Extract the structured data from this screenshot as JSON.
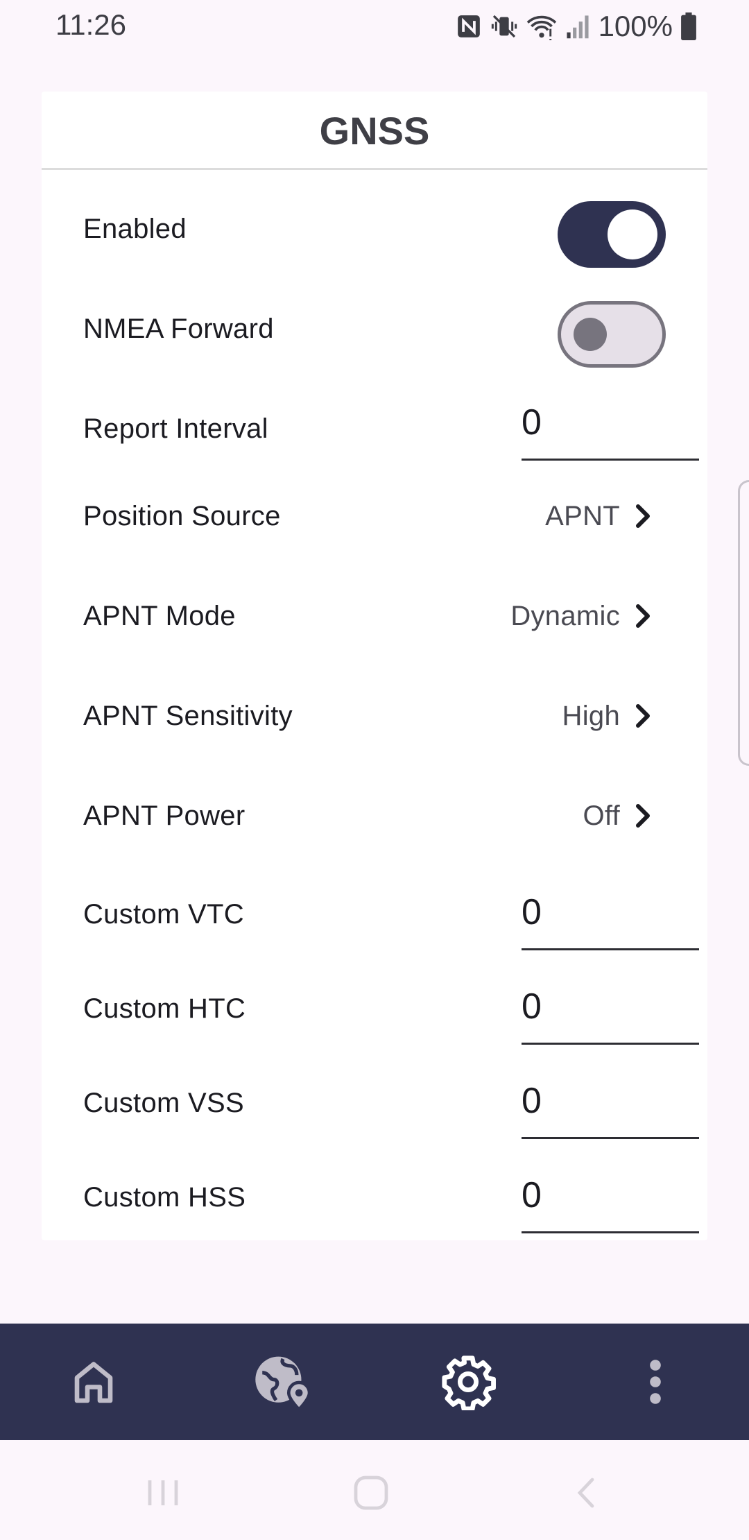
{
  "status_bar": {
    "time": "11:26",
    "battery": "100%",
    "icons": [
      "nfc-icon",
      "vibrate-mute-icon",
      "wifi-icon",
      "signal-icon",
      "battery-icon"
    ]
  },
  "card": {
    "title": "GNSS",
    "rows": {
      "enabled": {
        "label": "Enabled",
        "toggle": "on"
      },
      "nmea_forward": {
        "label": "NMEA Forward",
        "toggle": "off"
      },
      "report_interval": {
        "label": "Report Interval",
        "value": "0"
      },
      "position_source": {
        "label": "Position Source",
        "value": "APNT"
      },
      "apnt_mode": {
        "label": "APNT Mode",
        "value": "Dynamic"
      },
      "apnt_sensitivity": {
        "label": "APNT Sensitivity",
        "value": "High"
      },
      "apnt_power": {
        "label": "APNT Power",
        "value": "Off"
      },
      "custom_vtc": {
        "label": "Custom VTC",
        "value": "0"
      },
      "custom_htc": {
        "label": "Custom HTC",
        "value": "0"
      },
      "custom_vss": {
        "label": "Custom VSS",
        "value": "0"
      },
      "custom_hss": {
        "label": "Custom HSS",
        "value": "0"
      }
    }
  },
  "bottom_nav": {
    "items": [
      "home-icon",
      "globe-location-icon",
      "settings-icon",
      "more-vert-icon"
    ],
    "active": "settings-icon"
  },
  "colors": {
    "background": "#fcf6fc",
    "accent": "#2f3251",
    "card": "#ffffff"
  }
}
